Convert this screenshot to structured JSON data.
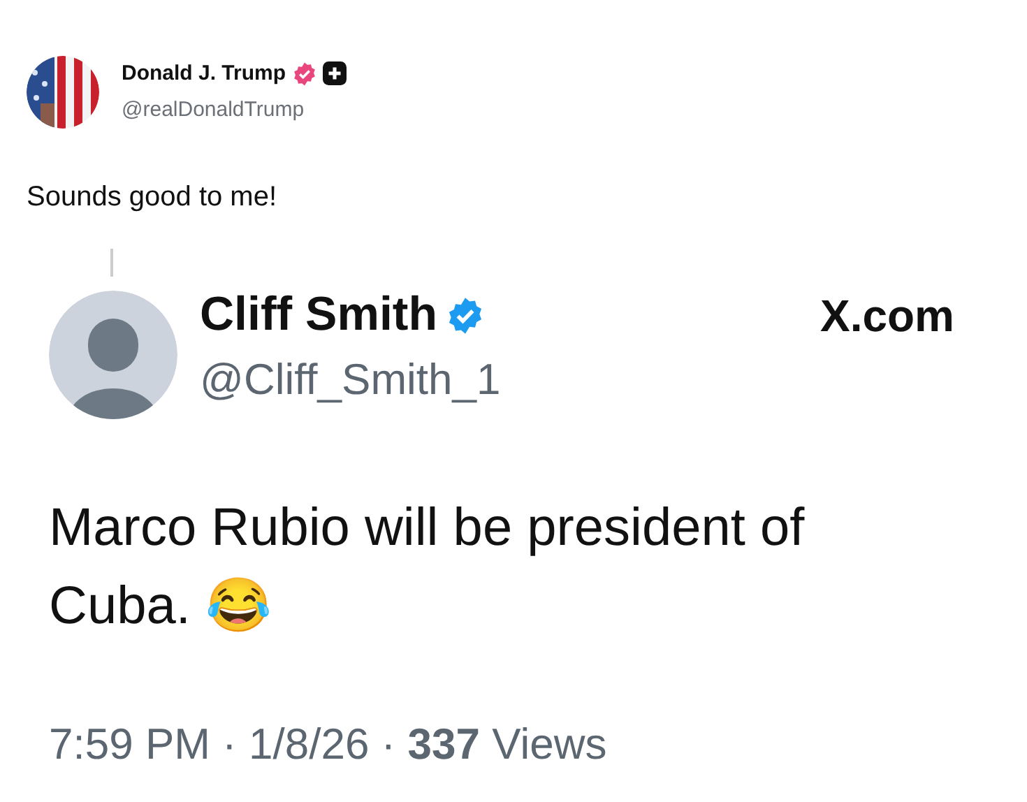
{
  "post": {
    "author": {
      "name": "Donald J. Trump",
      "handle": "@realDonaldTrump",
      "verified": true
    },
    "text": "Sounds good to me!"
  },
  "quoted_post": {
    "author": {
      "name": "Cliff Smith",
      "handle": "@Cliff_Smith_1",
      "verified": true
    },
    "source": "X.com",
    "text": "Marco Rubio will be president of Cuba. 😂",
    "meta": "7:59 PM · 1/8/26 · **337** Views"
  }
}
